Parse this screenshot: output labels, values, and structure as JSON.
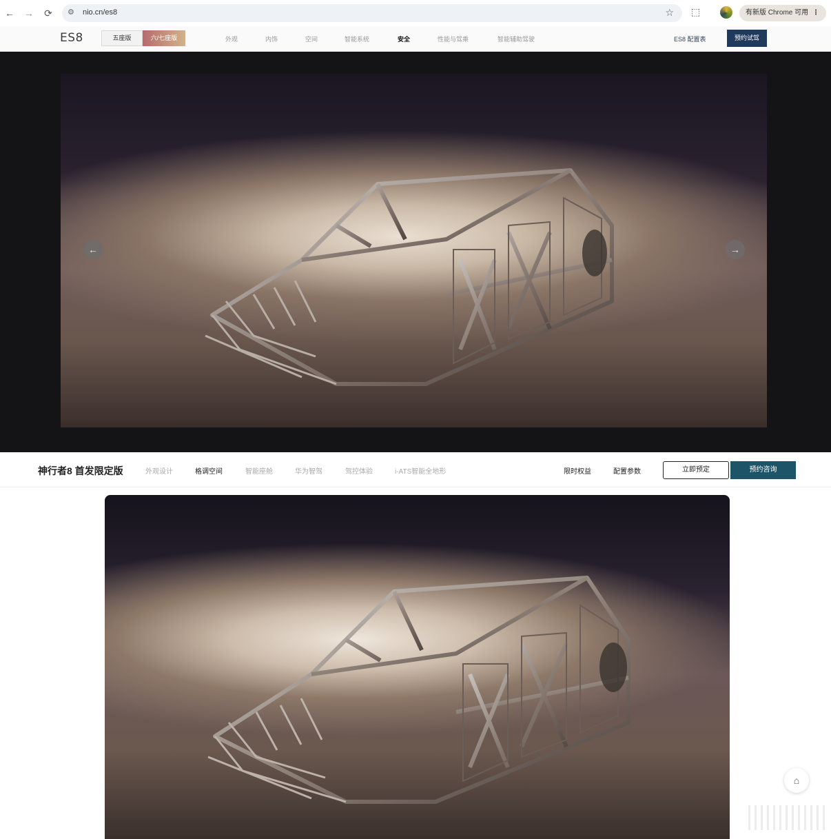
{
  "browser": {
    "url": "nio.cn/es8",
    "update_pill": "有新版 Chrome 可用",
    "menu_dots": "⋮"
  },
  "header": {
    "logo": "ES8",
    "seat_tabs": [
      "五座版",
      "六/七座版"
    ],
    "nav_items": [
      "外观",
      "内饰",
      "空间",
      "智能系统",
      "安全",
      "性能与驾乘",
      "智能辅助驾驶"
    ],
    "active_nav": "安全",
    "config_link": "ES8 配置表",
    "test_drive": "预约试驾"
  },
  "subbar": {
    "title": "神行者8 首发限定版",
    "nav_items": [
      "外观设计",
      "格调空间",
      "智能座舱",
      "华为智驾",
      "驾控体验",
      "i-ATS智能全地形"
    ],
    "active_nav": "格调空间",
    "right_links": [
      "限时权益",
      "配置参数"
    ],
    "reserve": "立即预定",
    "consult": "预约咨询"
  },
  "icons": {
    "back": "arrow-left-icon",
    "forward": "arrow-right-icon",
    "reload": "reload-icon",
    "site_info": "site-info-icon",
    "bookmark": "star-icon",
    "extensions": "extensions-icon",
    "carousel_prev": "chevron-left-icon",
    "carousel_next": "chevron-right-icon",
    "chat": "chat-icon"
  },
  "colors": {
    "seat_tab_gradient_start": "#b66b6d",
    "seat_tab_gradient_end": "#d2b28a",
    "test_drive_bg": "#1f3a5c",
    "consult_bg": "#1d5468",
    "hero_bg": "#141316"
  }
}
